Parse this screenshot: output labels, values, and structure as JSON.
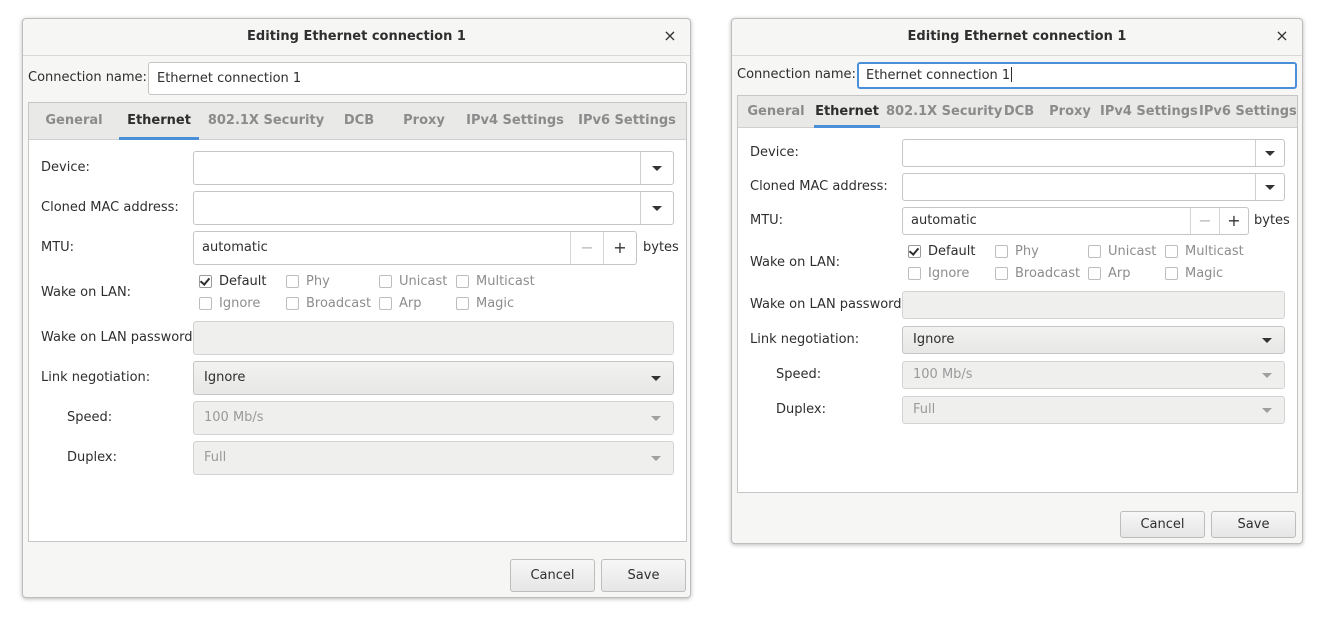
{
  "dialogs": [
    {
      "title": "Editing Ethernet connection 1",
      "close_glyph": "×",
      "connection_name_label": "Connection name:",
      "connection_name_value": "Ethernet connection 1",
      "tabs": [
        "General",
        "Ethernet",
        "802.1X Security",
        "DCB",
        "Proxy",
        "IPv4 Settings",
        "IPv6 Settings"
      ],
      "active_tab": "Ethernet",
      "device_label": "Device:",
      "device_value": "",
      "cloned_mac_label": "Cloned MAC address:",
      "cloned_mac_value": "",
      "mtu_label": "MTU:",
      "mtu_value": "automatic",
      "mtu_minus": "−",
      "mtu_plus": "+",
      "mtu_unit": "bytes",
      "wol_label": "Wake on LAN:",
      "wol_options": [
        {
          "label": "Default",
          "checked": true
        },
        {
          "label": "Phy",
          "checked": false
        },
        {
          "label": "Unicast",
          "checked": false
        },
        {
          "label": "Multicast",
          "checked": false
        },
        {
          "label": "Ignore",
          "checked": false
        },
        {
          "label": "Broadcast",
          "checked": false
        },
        {
          "label": "Arp",
          "checked": false
        },
        {
          "label": "Magic",
          "checked": false
        }
      ],
      "wol_password_label": "Wake on LAN password:",
      "wol_password_value": "",
      "link_negotiation_label": "Link negotiation:",
      "link_negotiation_value": "Ignore",
      "speed_label": "Speed:",
      "speed_value": "100 Mb/s",
      "duplex_label": "Duplex:",
      "duplex_value": "Full",
      "cancel_label": "Cancel",
      "save_label": "Save"
    },
    {
      "title": "Editing Ethernet connection 1",
      "close_glyph": "×",
      "connection_name_label": "Connection name:",
      "connection_name_value": "Ethernet connection 1",
      "tabs": [
        "General",
        "Ethernet",
        "802.1X Security",
        "DCB",
        "Proxy",
        "IPv4 Settings",
        "IPv6 Settings"
      ],
      "active_tab": "Ethernet",
      "device_label": "Device:",
      "device_value": "",
      "cloned_mac_label": "Cloned MAC address:",
      "cloned_mac_value": "",
      "mtu_label": "MTU:",
      "mtu_value": "automatic",
      "mtu_minus": "−",
      "mtu_plus": "+",
      "mtu_unit": "bytes",
      "wol_label": "Wake on LAN:",
      "wol_options": [
        {
          "label": "Default",
          "checked": true
        },
        {
          "label": "Phy",
          "checked": false
        },
        {
          "label": "Unicast",
          "checked": false
        },
        {
          "label": "Multicast",
          "checked": false
        },
        {
          "label": "Ignore",
          "checked": false
        },
        {
          "label": "Broadcast",
          "checked": false
        },
        {
          "label": "Arp",
          "checked": false
        },
        {
          "label": "Magic",
          "checked": false
        }
      ],
      "wol_password_label": "Wake on LAN password:",
      "wol_password_value": "",
      "link_negotiation_label": "Link negotiation:",
      "link_negotiation_value": "Ignore",
      "speed_label": "Speed:",
      "speed_value": "100 Mb/s",
      "duplex_label": "Duplex:",
      "duplex_value": "Full",
      "cancel_label": "Cancel",
      "save_label": "Save"
    }
  ],
  "colors": {
    "accent": "#4a90d9",
    "window_bg": "#f6f6f5",
    "tabbar_bg": "#e9e9e8",
    "inactive_tab_text": "#8b8b8b",
    "disabled_text": "#9a9a9a"
  },
  "icons": {
    "close": "close-icon",
    "dropdown": "chevron-down-icon",
    "check": "checkmark-icon"
  }
}
